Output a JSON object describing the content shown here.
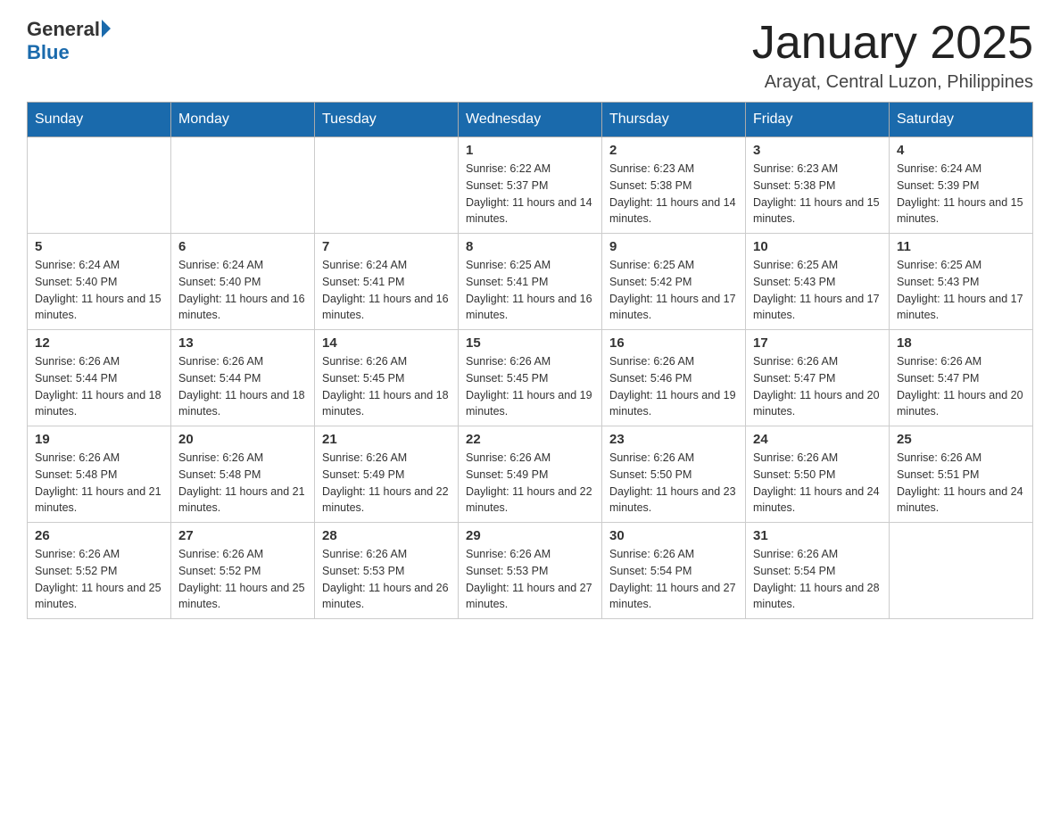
{
  "header": {
    "logo": {
      "general_text": "General",
      "blue_text": "Blue"
    },
    "title": "January 2025",
    "subtitle": "Arayat, Central Luzon, Philippines"
  },
  "calendar": {
    "days_of_week": [
      "Sunday",
      "Monday",
      "Tuesday",
      "Wednesday",
      "Thursday",
      "Friday",
      "Saturday"
    ],
    "weeks": [
      [
        {
          "day": "",
          "info": ""
        },
        {
          "day": "",
          "info": ""
        },
        {
          "day": "",
          "info": ""
        },
        {
          "day": "1",
          "info": "Sunrise: 6:22 AM\nSunset: 5:37 PM\nDaylight: 11 hours and 14 minutes."
        },
        {
          "day": "2",
          "info": "Sunrise: 6:23 AM\nSunset: 5:38 PM\nDaylight: 11 hours and 14 minutes."
        },
        {
          "day": "3",
          "info": "Sunrise: 6:23 AM\nSunset: 5:38 PM\nDaylight: 11 hours and 15 minutes."
        },
        {
          "day": "4",
          "info": "Sunrise: 6:24 AM\nSunset: 5:39 PM\nDaylight: 11 hours and 15 minutes."
        }
      ],
      [
        {
          "day": "5",
          "info": "Sunrise: 6:24 AM\nSunset: 5:40 PM\nDaylight: 11 hours and 15 minutes."
        },
        {
          "day": "6",
          "info": "Sunrise: 6:24 AM\nSunset: 5:40 PM\nDaylight: 11 hours and 16 minutes."
        },
        {
          "day": "7",
          "info": "Sunrise: 6:24 AM\nSunset: 5:41 PM\nDaylight: 11 hours and 16 minutes."
        },
        {
          "day": "8",
          "info": "Sunrise: 6:25 AM\nSunset: 5:41 PM\nDaylight: 11 hours and 16 minutes."
        },
        {
          "day": "9",
          "info": "Sunrise: 6:25 AM\nSunset: 5:42 PM\nDaylight: 11 hours and 17 minutes."
        },
        {
          "day": "10",
          "info": "Sunrise: 6:25 AM\nSunset: 5:43 PM\nDaylight: 11 hours and 17 minutes."
        },
        {
          "day": "11",
          "info": "Sunrise: 6:25 AM\nSunset: 5:43 PM\nDaylight: 11 hours and 17 minutes."
        }
      ],
      [
        {
          "day": "12",
          "info": "Sunrise: 6:26 AM\nSunset: 5:44 PM\nDaylight: 11 hours and 18 minutes."
        },
        {
          "day": "13",
          "info": "Sunrise: 6:26 AM\nSunset: 5:44 PM\nDaylight: 11 hours and 18 minutes."
        },
        {
          "day": "14",
          "info": "Sunrise: 6:26 AM\nSunset: 5:45 PM\nDaylight: 11 hours and 18 minutes."
        },
        {
          "day": "15",
          "info": "Sunrise: 6:26 AM\nSunset: 5:45 PM\nDaylight: 11 hours and 19 minutes."
        },
        {
          "day": "16",
          "info": "Sunrise: 6:26 AM\nSunset: 5:46 PM\nDaylight: 11 hours and 19 minutes."
        },
        {
          "day": "17",
          "info": "Sunrise: 6:26 AM\nSunset: 5:47 PM\nDaylight: 11 hours and 20 minutes."
        },
        {
          "day": "18",
          "info": "Sunrise: 6:26 AM\nSunset: 5:47 PM\nDaylight: 11 hours and 20 minutes."
        }
      ],
      [
        {
          "day": "19",
          "info": "Sunrise: 6:26 AM\nSunset: 5:48 PM\nDaylight: 11 hours and 21 minutes."
        },
        {
          "day": "20",
          "info": "Sunrise: 6:26 AM\nSunset: 5:48 PM\nDaylight: 11 hours and 21 minutes."
        },
        {
          "day": "21",
          "info": "Sunrise: 6:26 AM\nSunset: 5:49 PM\nDaylight: 11 hours and 22 minutes."
        },
        {
          "day": "22",
          "info": "Sunrise: 6:26 AM\nSunset: 5:49 PM\nDaylight: 11 hours and 22 minutes."
        },
        {
          "day": "23",
          "info": "Sunrise: 6:26 AM\nSunset: 5:50 PM\nDaylight: 11 hours and 23 minutes."
        },
        {
          "day": "24",
          "info": "Sunrise: 6:26 AM\nSunset: 5:50 PM\nDaylight: 11 hours and 24 minutes."
        },
        {
          "day": "25",
          "info": "Sunrise: 6:26 AM\nSunset: 5:51 PM\nDaylight: 11 hours and 24 minutes."
        }
      ],
      [
        {
          "day": "26",
          "info": "Sunrise: 6:26 AM\nSunset: 5:52 PM\nDaylight: 11 hours and 25 minutes."
        },
        {
          "day": "27",
          "info": "Sunrise: 6:26 AM\nSunset: 5:52 PM\nDaylight: 11 hours and 25 minutes."
        },
        {
          "day": "28",
          "info": "Sunrise: 6:26 AM\nSunset: 5:53 PM\nDaylight: 11 hours and 26 minutes."
        },
        {
          "day": "29",
          "info": "Sunrise: 6:26 AM\nSunset: 5:53 PM\nDaylight: 11 hours and 27 minutes."
        },
        {
          "day": "30",
          "info": "Sunrise: 6:26 AM\nSunset: 5:54 PM\nDaylight: 11 hours and 27 minutes."
        },
        {
          "day": "31",
          "info": "Sunrise: 6:26 AM\nSunset: 5:54 PM\nDaylight: 11 hours and 28 minutes."
        },
        {
          "day": "",
          "info": ""
        }
      ]
    ]
  }
}
